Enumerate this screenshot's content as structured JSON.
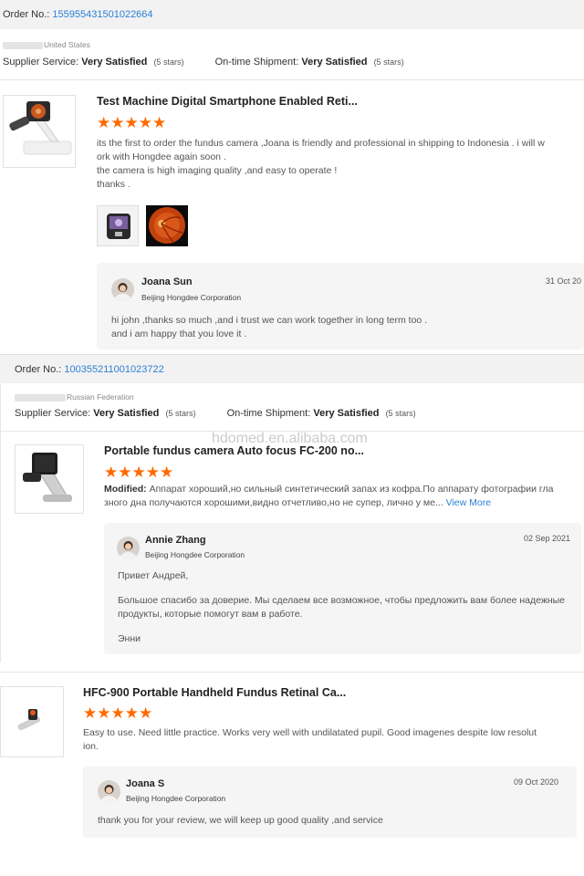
{
  "orders": [
    {
      "order_label": "Order No.:",
      "order_number": "155955431501022664",
      "country": "United States",
      "supplier_label": "Supplier Service:",
      "supplier_value": "Very Satisfied",
      "supplier_stars": "(5 stars)",
      "shipment_label": "On-time Shipment:",
      "shipment_value": "Very Satisfied",
      "shipment_stars": "(5 stars)",
      "product_title": "Test Machine Digital Smartphone Enabled Reti...",
      "stars": "★★★★★",
      "review_lines": [
        "its the first to order the fundus camera ,Joana is friendly and professional in shipping to Indonesia . i will w",
        "ork with Hongdee again soon .",
        "the camera is high imaging quality ,and easy to operate !",
        "thanks ."
      ],
      "reply": {
        "name": "Joana Sun",
        "company": "Beijing Hongdee Corporation",
        "date": "31 Oct 20",
        "lines": [
          "hi john ,thanks so much ,and i trust we can work together in long term too .",
          "and i am happy that you love it ."
        ]
      }
    },
    {
      "order_label": "Order No.:",
      "order_number": "100355211001023722",
      "country": "Russian Federation",
      "supplier_label": "Supplier Service:",
      "supplier_value": "Very Satisfied",
      "supplier_stars": "(5 stars)",
      "shipment_label": "On-time Shipment:",
      "shipment_value": "Very Satisfied",
      "shipment_stars": "(5 stars)",
      "product_title": "Portable fundus camera Auto focus FC-200 no...",
      "stars": "★★★★★",
      "modified_label": "Modified:",
      "review_line1": "Аппарат хороший,но сильный синтетический запах из кофра.По аппарату фотографии гла",
      "review_line2": "зного дна  получаются хорошими,видно отчетливо,но не супер, лично у ме...",
      "view_more": "View More",
      "reply": {
        "name": "Annie Zhang",
        "company": "Beijing Hongdee Corporation",
        "date": "02 Sep 2021",
        "line1": "Привет Андрей,",
        "line2": "Большое спасибо за доверие. Мы сделаем все возможное, чтобы предложить вам более надежные",
        "line3": "продукты, которые помогут вам в работе.",
        "line4": "Энни"
      }
    },
    {
      "product_title": "HFC-900 Portable Handheld Fundus Retinal Ca...",
      "stars": "★★★★★",
      "review_lines": [
        "Easy to use. Need little practice. Works very well with undilatated pupil. Good imagenes despite low resolut",
        "ion."
      ],
      "reply": {
        "name": "Joana S",
        "company": "Beijing Hongdee Corporation",
        "date": "09 Oct 2020",
        "line1": "thank you for your review, we will keep up good quality ,and service"
      }
    }
  ],
  "watermark": "hdomed.en.alibaba.com",
  "colors": {
    "star": "#ff6a00",
    "link": "#2a7fd4",
    "bar": "#f2f2f2",
    "reply_bg": "#f5f5f5"
  }
}
